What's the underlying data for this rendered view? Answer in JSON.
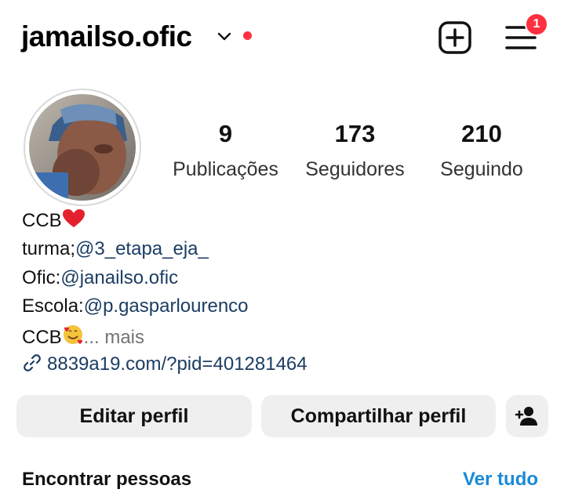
{
  "header": {
    "username": "jamailso.ofic",
    "menu_badge": "1",
    "notification_dot_color": "#ff3040"
  },
  "stats": [
    {
      "value": "9",
      "label": "Publicações"
    },
    {
      "value": "173",
      "label": "Seguidores"
    },
    {
      "value": "210",
      "label": "Seguindo"
    }
  ],
  "bio": {
    "line1_text": "CCB",
    "line1_emoji": "red-heart-icon",
    "line2_prefix": "turma;",
    "line2_mention": "@3_etapa_eja_",
    "line3_prefix": "Ofic:",
    "line3_mention": "@janailso.ofic",
    "line4_prefix": "Escola:",
    "line4_mention": "@p.gasparlourenco",
    "line5_text": "CCB",
    "line5_emoji": "smiling-face-with-hearts-icon",
    "line5_more": "... mais",
    "link": "8839a19.com/?pid=401281464"
  },
  "actions": {
    "edit_label": "Editar perfil",
    "share_label": "Compartilhar perfil",
    "add_person_icon": "add-person-icon"
  },
  "discover": {
    "title": "Encontrar pessoas",
    "see_all": "Ver tudo",
    "see_all_color": "#1a8ad8"
  }
}
